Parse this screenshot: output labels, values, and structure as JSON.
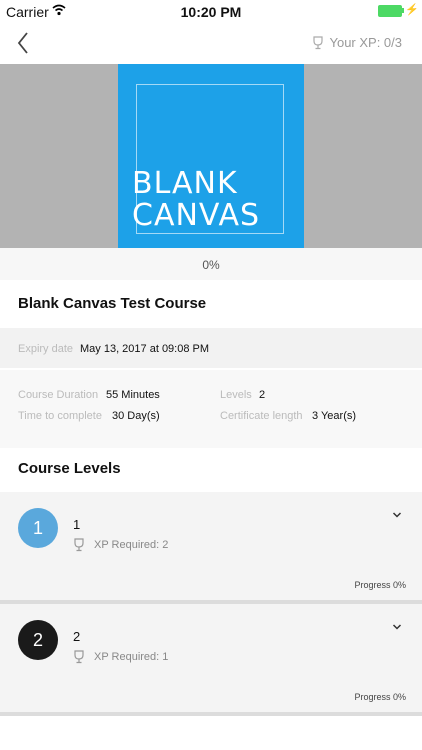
{
  "status_bar": {
    "carrier": "Carrier",
    "time": "10:20 PM"
  },
  "nav": {
    "xp_text": "Your XP: 0/3"
  },
  "hero": {
    "line1": "BLANK",
    "line2": "CANVAS",
    "tile_color": "#1da1e8"
  },
  "progress_text": "0%",
  "course_title": "Blank Canvas Test Course",
  "expiry": {
    "label": "Expiry date",
    "value": "May 13, 2017 at 09:08 PM"
  },
  "details": {
    "duration_label": "Course Duration",
    "duration_value": "55 Minutes",
    "levels_label": "Levels",
    "levels_value": "2",
    "time_label": "Time to complete",
    "time_value": "30 Day(s)",
    "cert_label": "Certificate length",
    "cert_value": "3 Year(s)"
  },
  "levels_heading": "Course Levels",
  "levels": [
    {
      "number": "1",
      "name": "1",
      "xp_required": "XP Required: 2",
      "progress": "Progress 0%",
      "color": "#5aa8dc"
    },
    {
      "number": "2",
      "name": "2",
      "xp_required": "XP Required: 1",
      "progress": "Progress 0%",
      "color": "#1a1a1a"
    }
  ]
}
